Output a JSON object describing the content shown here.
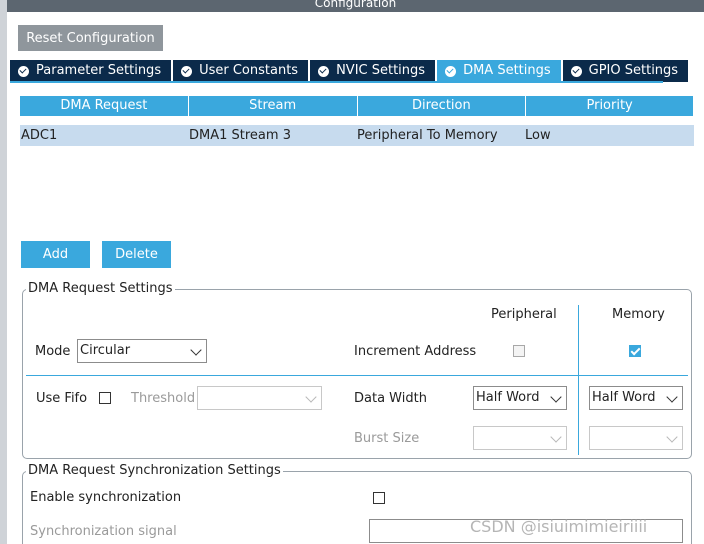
{
  "window": {
    "title": "Configuration"
  },
  "toolbar": {
    "reset_label": "Reset Configuration"
  },
  "tabs": [
    {
      "label": "Parameter Settings",
      "active": false
    },
    {
      "label": "User Constants",
      "active": false
    },
    {
      "label": "NVIC Settings",
      "active": false
    },
    {
      "label": "DMA Settings",
      "active": true
    },
    {
      "label": "GPIO Settings",
      "active": false
    }
  ],
  "dma_table": {
    "columns": [
      "DMA Request",
      "Stream",
      "Direction",
      "Priority"
    ],
    "rows": [
      [
        "ADC1",
        "DMA1 Stream 3",
        "Peripheral To Memory",
        "Low"
      ]
    ]
  },
  "actions": {
    "add_label": "Add",
    "delete_label": "Delete"
  },
  "request_settings": {
    "title": "DMA Request Settings",
    "peripheral_header": "Peripheral",
    "memory_header": "Memory",
    "mode_label": "Mode",
    "mode_value": "Circular",
    "increment_label": "Increment Address",
    "increment_peripheral": false,
    "increment_memory": true,
    "fifo_label": "Use Fifo",
    "fifo_checked": false,
    "threshold_label": "Threshold",
    "threshold_value": "",
    "data_width_label": "Data Width",
    "data_width_peripheral": "Half Word",
    "data_width_memory": "Half Word",
    "burst_label": "Burst Size",
    "burst_peripheral": "",
    "burst_memory": ""
  },
  "sync_settings": {
    "title": "DMA Request Synchronization Settings",
    "enable_label": "Enable synchronization",
    "enable_checked": false,
    "signal_label": "Synchronization signal",
    "signal_value": ""
  },
  "watermark": {
    "text": "CSDN @іѕіuіmіmіeіrіііі"
  },
  "colors": {
    "accent": "#3aa8dd",
    "tab_dark": "#0b2a4a",
    "row_selected": "#c7dbee",
    "reset_gray": "#8f969c"
  },
  "icons": {
    "tab_status": "check-circle-icon",
    "dropdown": "chevron-down-icon",
    "checkbox_checked": "checkmark-icon"
  }
}
